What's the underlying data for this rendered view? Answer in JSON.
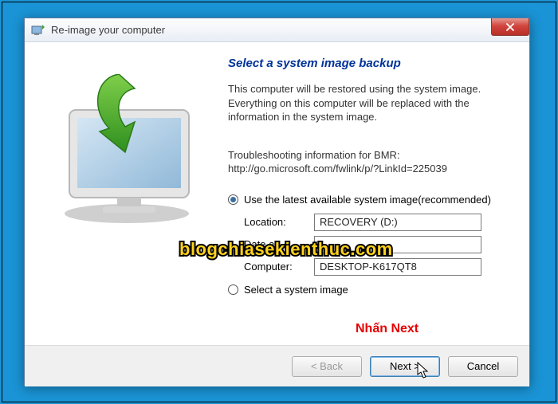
{
  "titlebar": {
    "title": "Re-image your computer"
  },
  "heading": "Select a system image backup",
  "description": "This computer will be restored using the system image. Everything on this computer will be replaced with the information in the system image.",
  "troubleshoot": {
    "line1": "Troubleshooting information for BMR:",
    "line2": "http://go.microsoft.com/fwlink/p/?LinkId=225039"
  },
  "options": {
    "radio1_label": "Use the latest available system image(recommended)",
    "radio2_label": "Select a system image"
  },
  "fields": {
    "location_label": "Location:",
    "location_value": "RECOVERY (D:)",
    "date_label": "Date a",
    "date_value": "",
    "computer_label": "Computer:",
    "computer_value": "DESKTOP-K617QT8"
  },
  "buttons": {
    "back": "< Back",
    "next": "Next >",
    "cancel": "Cancel"
  },
  "watermark": "blogchiasekienthuc.com",
  "annotation": "Nhấn Next"
}
